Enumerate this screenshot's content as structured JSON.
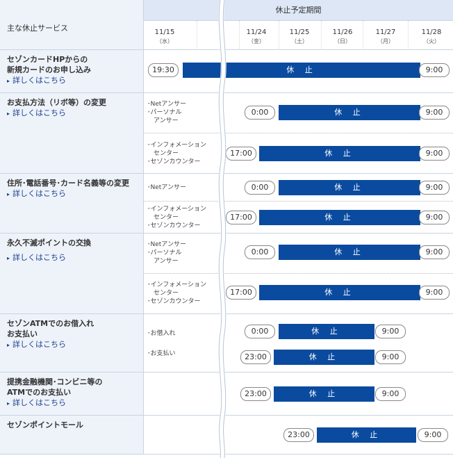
{
  "header": {
    "service_col": "主な休止サービス",
    "period": "休止予定期間",
    "dates": [
      {
        "date": "11/15",
        "dow": "（水）"
      },
      {
        "date": "11/24",
        "dow": "（金）"
      },
      {
        "date": "11/25",
        "dow": "（土）"
      },
      {
        "date": "11/26",
        "dow": "（日）"
      },
      {
        "date": "11/27",
        "dow": "（月）"
      },
      {
        "date": "11/28",
        "dow": "（火）"
      }
    ]
  },
  "bar_label": "休 止",
  "link_text": "詳しくはこちら",
  "services": [
    {
      "title_l1": "セゾンカードHPからの",
      "title_l2": "新規カードのお申し込み",
      "rows": [
        {
          "channel_l1": "",
          "channel_l2": "",
          "channel_l3": "",
          "start": "19:30",
          "end": "9:00"
        }
      ]
    },
    {
      "title_l1": "お支払方法（リボ等）の変更",
      "rows": [
        {
          "channel_l1": "･Netアンサー",
          "channel_l2": "･パーソナル",
          "channel_l3": "　アンサー",
          "start": "0:00",
          "end": "9:00"
        },
        {
          "channel_l1": "･インフォメーション",
          "channel_l2": "　センター",
          "channel_l3": "･セゾンカウンター",
          "start": "17:00",
          "end": "9:00"
        }
      ]
    },
    {
      "title_l1": "住所･電話番号･カード名義等の変更",
      "rows": [
        {
          "channel_l1": "･Netアンサー",
          "start": "0:00",
          "end": "9:00"
        },
        {
          "channel_l1": "･インフォメーション",
          "channel_l2": "　センター",
          "channel_l3": "･セゾンカウンター",
          "start": "17:00",
          "end": "9:00"
        }
      ]
    },
    {
      "title_l1": "永久不滅ポイントの交換",
      "rows": [
        {
          "channel_l1": "･Netアンサー",
          "channel_l2": "･パーソナル",
          "channel_l3": "　アンサー",
          "start": "0:00",
          "end": "9:00"
        },
        {
          "channel_l1": "･インフォメーション",
          "channel_l2": "　センター",
          "channel_l3": "･セゾンカウンター",
          "start": "17:00",
          "end": "9:00"
        }
      ]
    },
    {
      "title_l1": "セゾンATMでのお借入れ",
      "title_l2": "お支払い",
      "rows": [
        {
          "channel_l1": "･お借入れ",
          "start": "0:00",
          "end": "9:00"
        },
        {
          "channel_l1": "･お支払い",
          "start": "23:00",
          "end": "9:00"
        }
      ]
    },
    {
      "title_l1": "提携金融機関･コンビニ等の",
      "title_l2": "ATMでのお支払い",
      "rows": [
        {
          "start": "23:00",
          "end": "9:00"
        }
      ]
    },
    {
      "title_l1": "セゾンポイントモール",
      "rows": [
        {
          "start": "23:00",
          "end": "9:00"
        }
      ]
    }
  ]
}
